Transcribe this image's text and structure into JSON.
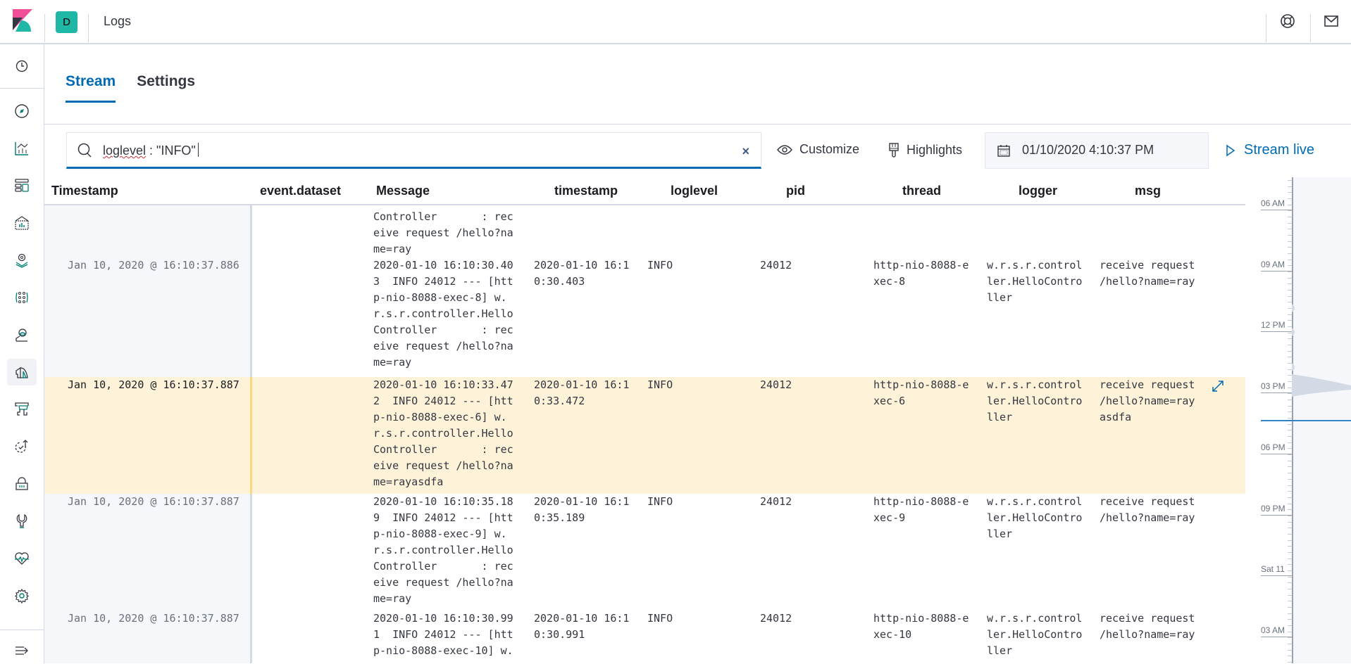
{
  "header": {
    "space_initial": "D",
    "app_title": "Logs",
    "icons": [
      "help-icon",
      "newsfeed-icon"
    ]
  },
  "sidenav": {
    "items": [
      {
        "name": "recently-viewed",
        "icon": "clock-icon"
      },
      {
        "name": "discover",
        "icon": "compass-icon"
      },
      {
        "name": "visualize",
        "icon": "visualize-icon"
      },
      {
        "name": "dashboard",
        "icon": "dashboard-icon"
      },
      {
        "name": "canvas",
        "icon": "canvas-icon"
      },
      {
        "name": "maps",
        "icon": "maps-icon"
      },
      {
        "name": "machine-learning",
        "icon": "ml-icon"
      },
      {
        "name": "infrastructure",
        "icon": "infra-icon"
      },
      {
        "name": "logs",
        "icon": "logs-icon",
        "active": true
      },
      {
        "name": "apm",
        "icon": "apm-icon"
      },
      {
        "name": "uptime",
        "icon": "uptime-icon"
      },
      {
        "name": "siem",
        "icon": "siem-icon"
      },
      {
        "name": "dev-tools",
        "icon": "wrench-icon"
      },
      {
        "name": "stack-monitoring",
        "icon": "heartbeat-icon"
      },
      {
        "name": "management",
        "icon": "gear-icon"
      },
      {
        "name": "dock-navigation",
        "icon": "menu-dock-icon"
      }
    ]
  },
  "tabs": [
    {
      "label": "Stream",
      "active": true
    },
    {
      "label": "Settings",
      "active": false
    }
  ],
  "toolbar": {
    "search_query_underlined": "loglevel",
    "search_query_rest": " : \"INFO\"",
    "clear_label": "×",
    "customize_label": "Customize",
    "highlights_label": "Highlights",
    "date_value": "01/10/2020 4:10:37 PM",
    "stream_live_label": "Stream live"
  },
  "columns": [
    "Timestamp",
    "event.dataset",
    "Message",
    "timestamp",
    "loglevel",
    "pid",
    "thread",
    "logger",
    "msg"
  ],
  "rows": [
    {
      "timestamp": "",
      "dataset": "",
      "message": "Controller       : rec\neive request /hello?na\nme=ray",
      "ts2": "",
      "loglevel": "",
      "pid": "",
      "thread": "",
      "logger": "",
      "msg": "",
      "partial": true
    },
    {
      "timestamp": "Jan 10, 2020 @ 16:10:37.886",
      "dataset": "",
      "message": "2020-01-10 16:10:30.40\n3  INFO 24012 --- [htt\np-nio-8088-exec-8] w.\nr.s.r.controller.Hello\nController       : rec\neive request /hello?na\nme=ray",
      "ts2": "2020-01-10 16:1\n0:30.403",
      "loglevel": "INFO",
      "pid": "24012",
      "thread": "http-nio-8088-e\nxec-8",
      "logger": "w.r.s.r.control\nler.HelloContro\nller",
      "msg": "receive request\n/hello?name=ray"
    },
    {
      "timestamp": "Jan 10, 2020 @ 16:10:37.887",
      "dataset": "",
      "message": "2020-01-10 16:10:33.47\n2  INFO 24012 --- [htt\np-nio-8088-exec-6] w.\nr.s.r.controller.Hello\nController       : rec\neive request /hello?na\nme=rayasdfa",
      "ts2": "2020-01-10 16:1\n0:33.472",
      "loglevel": "INFO",
      "pid": "24012",
      "thread": "http-nio-8088-e\nxec-6",
      "logger": "w.r.s.r.control\nler.HelloContro\nller",
      "msg": "receive request\n/hello?name=ray\nasdfa",
      "highlighted": true
    },
    {
      "timestamp": "Jan 10, 2020 @ 16:10:37.887",
      "dataset": "",
      "message": "2020-01-10 16:10:35.18\n9  INFO 24012 --- [htt\np-nio-8088-exec-9] w.\nr.s.r.controller.Hello\nController       : rec\neive request /hello?na\nme=ray",
      "ts2": "2020-01-10 16:1\n0:35.189",
      "loglevel": "INFO",
      "pid": "24012",
      "thread": "http-nio-8088-e\nxec-9",
      "logger": "w.r.s.r.control\nler.HelloContro\nller",
      "msg": "receive request\n/hello?name=ray"
    },
    {
      "timestamp": "Jan 10, 2020 @ 16:10:37.887",
      "dataset": "",
      "message": "2020-01-10 16:10:30.99\n1  INFO 24012 --- [htt\np-nio-8088-exec-10] w.",
      "ts2": "2020-01-10 16:1\n0:30.991",
      "loglevel": "INFO",
      "pid": "24012",
      "thread": "http-nio-8088-e\nxec-10",
      "logger": "w.r.s.r.control\nler.HelloContro\nller",
      "msg": "receive request\n/hello?name=ray"
    }
  ],
  "minimap": {
    "labels": [
      "06 AM",
      "09 AM",
      "12 PM",
      "03 PM",
      "06 PM",
      "09 PM",
      "Sat 11",
      "03 AM"
    ]
  },
  "colors": {
    "accent": "#006bb4",
    "highlight_row": "#fef3d9",
    "highlight_border": "#fcd883",
    "space_avatar": "#1fb7a6"
  }
}
